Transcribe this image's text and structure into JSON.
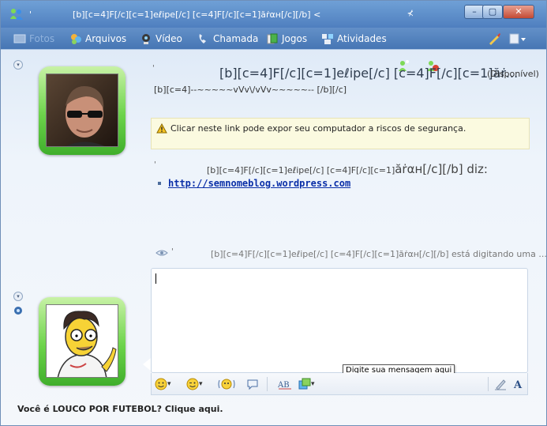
{
  "window": {
    "title_prefix": "'",
    "title": "[b][c=4]F[/c][c=1]eℓipe[/c] [c=4]F[/c][c=1]ăṙαн[/c][/b] <",
    "controls": {
      "minimize": "–",
      "maximize": "▢",
      "close": "✕"
    }
  },
  "toolbar": {
    "items": [
      {
        "label": "Fotos",
        "icon": "photos-icon"
      },
      {
        "label": "Arquivos",
        "icon": "files-icon"
      },
      {
        "label": "Vídeo",
        "icon": "video-icon"
      },
      {
        "label": "Chamada",
        "icon": "phone-icon"
      },
      {
        "label": "Jogos",
        "icon": "games-icon"
      },
      {
        "label": "Atividades",
        "icon": "activities-icon"
      }
    ]
  },
  "contact": {
    "tick": "'",
    "name": "[b][c=4]F[/c][c=1]eℓipe[/c] [c=4]F[/c][c=1]ăṙ...",
    "status": "(Disponível)",
    "personal_message": "[b][c=4]--~~~~~vVv\\/vVv~~~~~-- [/b][/c]"
  },
  "warning": {
    "text": "Clicar neste link pode expor seu computador a riscos de segurança."
  },
  "message": {
    "tick": "'",
    "sender": "[b][c=4]F[/c][c=1]eℓipe[/c] [c=4]F[/c][c=1]",
    "sender_big": "ăṙαн[/c][/b]",
    "says": " diz:",
    "link": "http://semnomeblog.wordpress.com"
  },
  "typing": {
    "tick": "'",
    "text": "[b][c=4]F[/c][c=1]eℓipe[/c] [c=4]F[/c][c=1]ăṙαн[/c][/b] está digitando uma ..."
  },
  "input": {
    "tooltip": "Digite sua mensagem aqui"
  },
  "format_bar": {
    "dropdown": "▾"
  },
  "footer": {
    "text": "Você é LOUCO POR FUTEBOL? Clique aqui."
  },
  "colors": {
    "accent": "#4f7fbf",
    "avatar_frame": "#6cd34a",
    "warning_bg": "#fbfae0",
    "link": "#0a2fa8"
  }
}
